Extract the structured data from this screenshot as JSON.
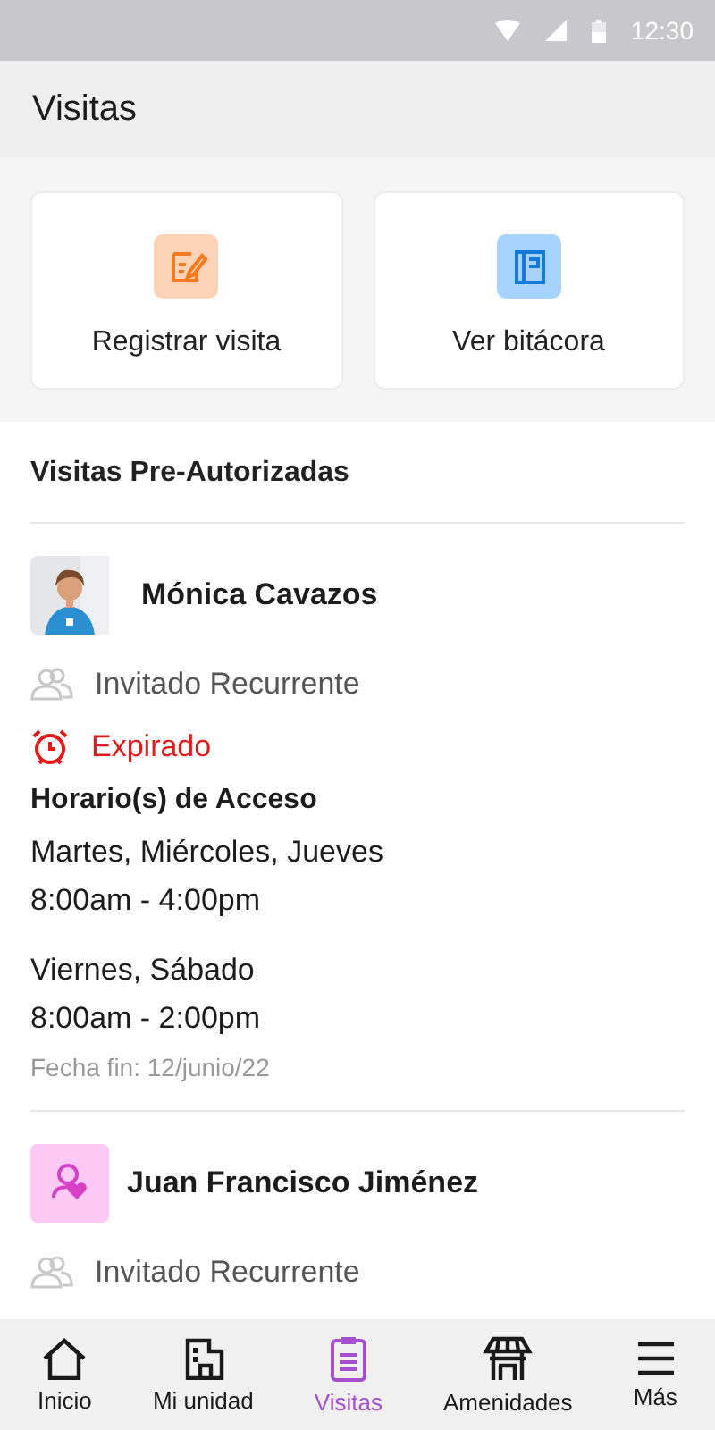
{
  "status_bar": {
    "time": "12:30"
  },
  "header": {
    "title": "Visitas"
  },
  "actions": [
    {
      "label": "Registrar visita",
      "kind": "register"
    },
    {
      "label": "Ver bitácora",
      "kind": "log"
    }
  ],
  "section_title": "Visitas Pre-Autorizadas",
  "visitors": [
    {
      "name": "Mónica Cavazos",
      "kind": "picture",
      "type": "Invitado Recurrente",
      "status": {
        "kind": "expired",
        "label": "Expirado"
      },
      "schedule_title": "Horario(s) de Acceso",
      "schedules": [
        {
          "days": "Martes, Miércoles, Jueves",
          "hours": "8:00am - 4:00pm"
        },
        {
          "days": "Viernes, Sábado",
          "hours": "8:00am - 2:00pm"
        }
      ],
      "end_date": "Fecha fin: 12/junio/22"
    },
    {
      "name": "Juan Francisco Jiménez",
      "kind": "icon",
      "type": "Invitado Recurrente"
    }
  ],
  "nav": [
    {
      "label": "Inicio",
      "kind": "home",
      "selected": false
    },
    {
      "label": "Mi unidad",
      "kind": "building",
      "selected": false
    },
    {
      "label": "Visitas",
      "kind": "clipboard",
      "selected": true
    },
    {
      "label": "Amenidades",
      "kind": "kiosk",
      "selected": false
    },
    {
      "label": "Más",
      "kind": "menu",
      "selected": false
    }
  ]
}
